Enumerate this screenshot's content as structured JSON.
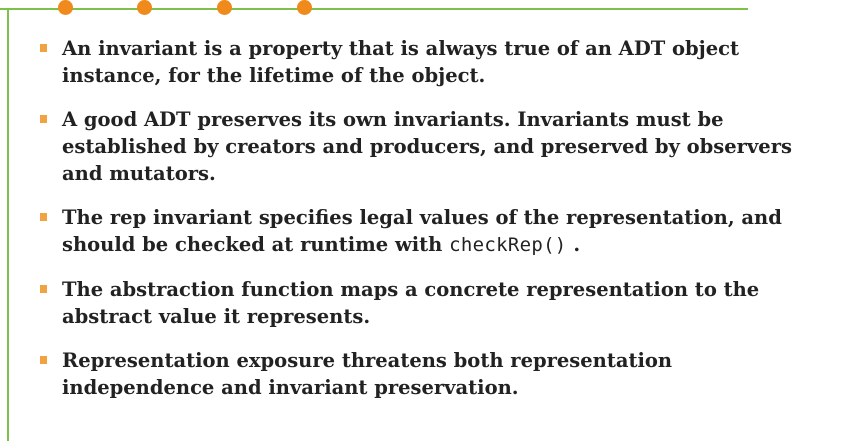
{
  "bullets": [
    {
      "text": "An invariant is a property that is always true of an ADT object instance, for the lifetime of the object."
    },
    {
      "text": "A good ADT preserves its own invariants. Invariants must be established by creators and producers, and preserved by observers and mutators."
    },
    {
      "text": "The rep invariant specifies legal values of the representation, and should be checked at runtime with ",
      "code": "checkRep()",
      "suffix": " ."
    },
    {
      "text": "The abstraction function maps a concrete representation to the abstract value it represents."
    },
    {
      "text": "Representation exposure threatens both representation independence and invariant preservation."
    }
  ],
  "colors": {
    "accent_line": "#7cc24a",
    "dots": "#f08a1c",
    "bullet_marker": "#f0a340",
    "text": "#222222"
  }
}
